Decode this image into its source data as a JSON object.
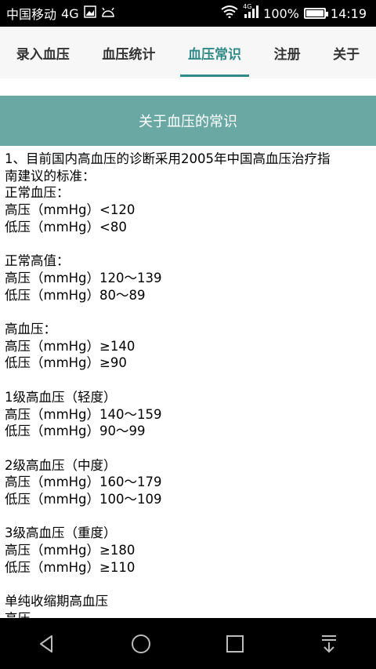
{
  "status_bar": {
    "carrier": "中国移动",
    "network": "4G",
    "network_small": "4G",
    "battery_percent": "100%",
    "time": "14:19"
  },
  "tabs": [
    {
      "label": "录入血压",
      "active": false
    },
    {
      "label": "血压统计",
      "active": false
    },
    {
      "label": "血压常识",
      "active": true
    },
    {
      "label": "注册",
      "active": false
    },
    {
      "label": "关于",
      "active": false
    }
  ],
  "header": {
    "title": "关于血压的常识"
  },
  "content": {
    "lines": [
      "1、目前国内高血压的诊断采用2005年中国高血压治疗指",
      "南建议的标准：",
      "正常血压：",
      "高压（mmHg）<120",
      "低压（mmHg）<80",
      "",
      "正常高值：",
      "高压（mmHg）120～139",
      "低压（mmHg）80～89",
      "",
      "高血压：",
      "高压（mmHg）≥140",
      "低压（mmHg）≥90",
      "",
      "1级高血压（轻度）",
      "高压（mmHg）140～159",
      "低压（mmHg）90～99",
      "",
      "2级高血压（中度）",
      "高压（mmHg）160～179",
      "低压（mmHg）100～109",
      "",
      "3级高血压（重度）",
      "高压（mmHg）≥180",
      "低压（mmHg）≥110",
      "",
      "单纯收缩期高血压",
      "高压"
    ]
  },
  "nav_bar": {
    "buttons": [
      "back-icon",
      "home-icon",
      "recents-icon",
      "notification-pull-icon"
    ]
  },
  "colors": {
    "accent": "#2f8a88",
    "header_bg": "#6aa8a4"
  }
}
